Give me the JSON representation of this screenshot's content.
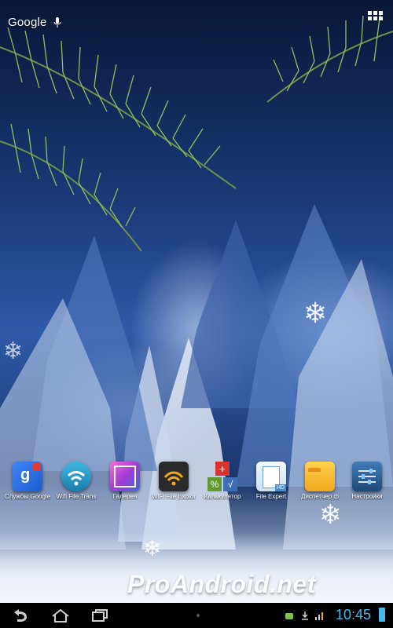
{
  "search": {
    "logo_text": "Google",
    "mic_icon": "mic-icon"
  },
  "apps_button_icon": "grid-icon",
  "dock": [
    {
      "label": "Службы Google",
      "icon": "google-services-icon",
      "color": "#3b6fd4"
    },
    {
      "label": "Wifi File Trans",
      "icon": "wifi-icon",
      "color": "#2b9fc9"
    },
    {
      "label": "Галерея",
      "icon": "gallery-icon",
      "color": "#c53bd0"
    },
    {
      "label": "WiFi File Explor",
      "icon": "wifi-explorer-icon",
      "color": "#2a2a2a"
    },
    {
      "label": "Калькулятор",
      "icon": "calculator-icon",
      "color": "#d8342f"
    },
    {
      "label": "File Expert",
      "icon": "file-expert-icon",
      "color": "#3a8fd6"
    },
    {
      "label": "Диспетчер ф",
      "icon": "folder-icon",
      "color": "#f0a81c"
    },
    {
      "label": "Настройки",
      "icon": "settings-icon",
      "color": "#2c5b8a"
    }
  ],
  "watermark": "ProAndroid.net",
  "status": {
    "clock": "10:45",
    "icons": [
      "android-debug-icon",
      "download-icon",
      "signal-icon"
    ]
  },
  "navbar": {
    "back_icon": "back-icon",
    "home_icon": "home-icon",
    "recents_icon": "recents-icon"
  },
  "colors": {
    "clock": "#4ab8e6",
    "navbar": "#000000"
  }
}
